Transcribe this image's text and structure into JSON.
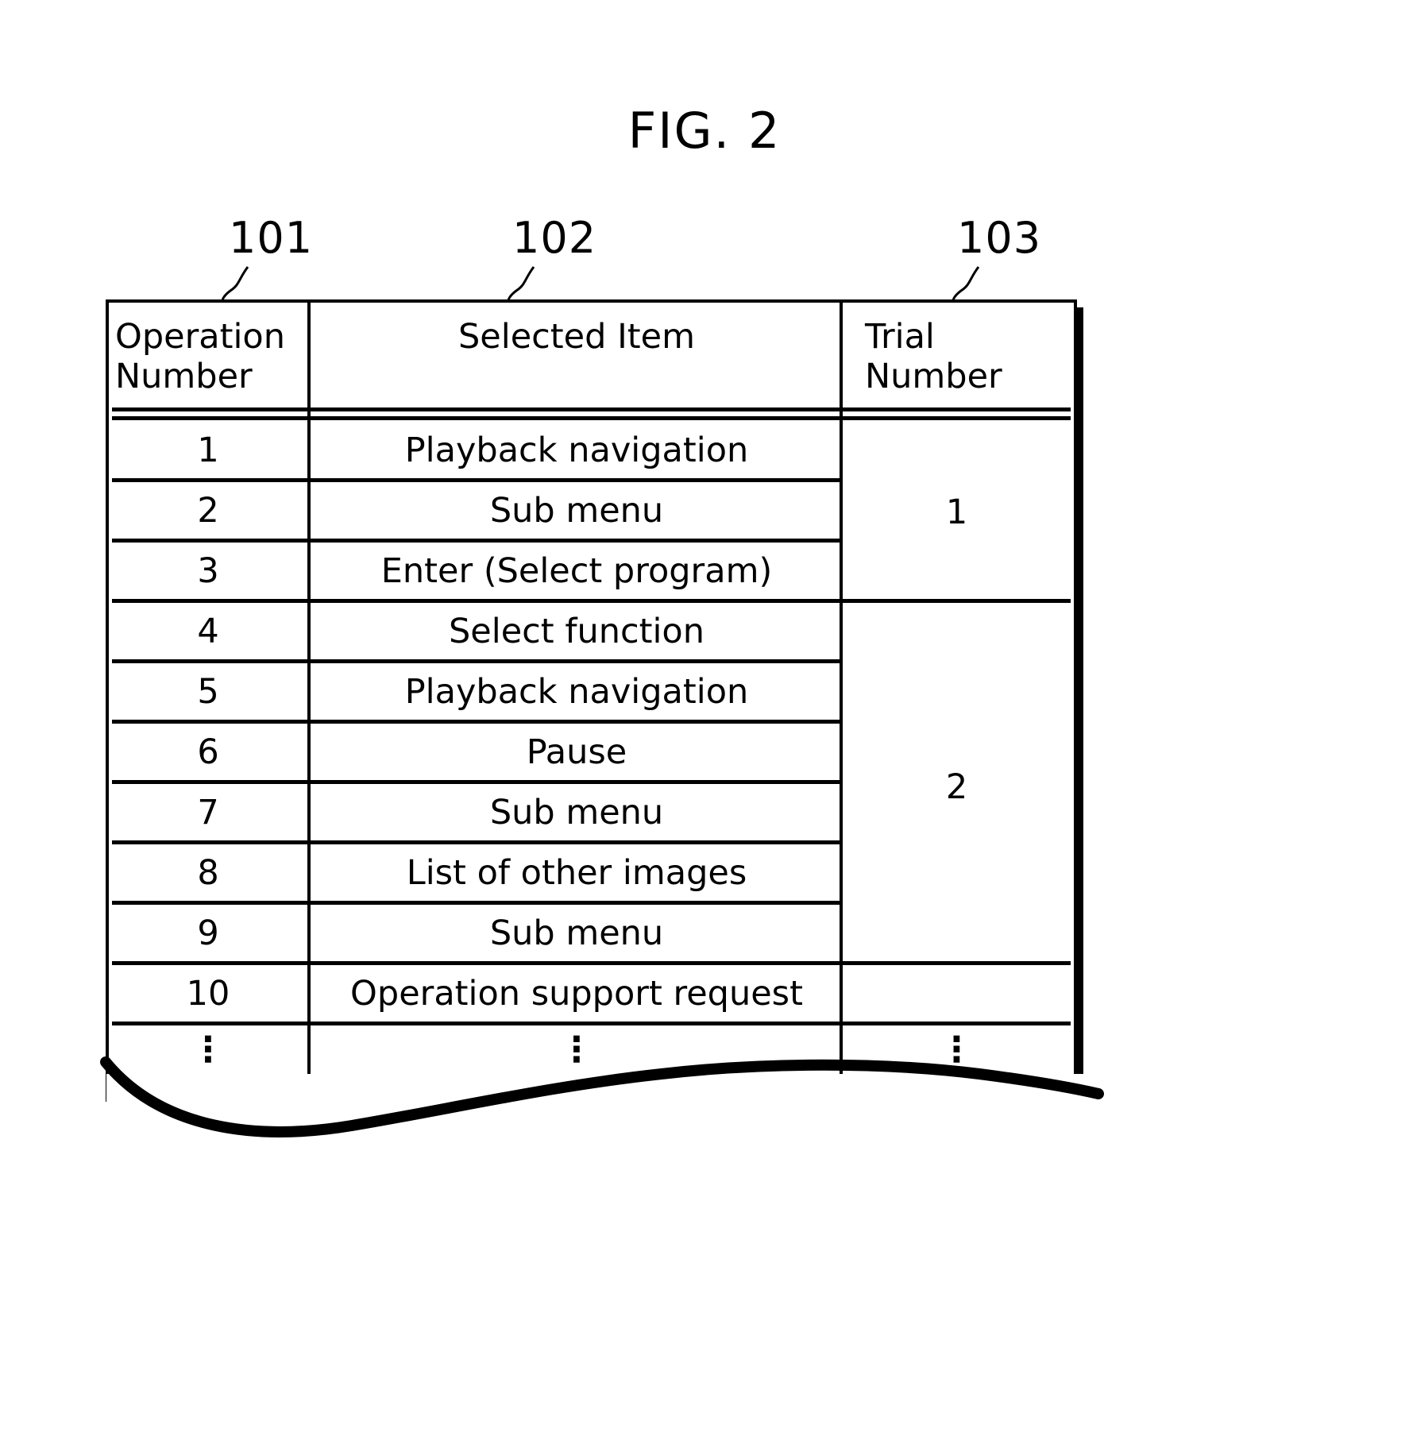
{
  "figure": {
    "title": "FIG. 2"
  },
  "callouts": [
    {
      "id": "101",
      "label": "101",
      "target": "operation-number-column"
    },
    {
      "id": "102",
      "label": "102",
      "target": "selected-item-column"
    },
    {
      "id": "103",
      "label": "103",
      "target": "trial-number-column"
    }
  ],
  "table": {
    "columns": [
      {
        "key": "operation_number",
        "header_line1": "Operation",
        "header_line2": "Number"
      },
      {
        "key": "selected_item",
        "header_line1": "Selected Item",
        "header_line2": ""
      },
      {
        "key": "trial_number",
        "header_line1": "Trial",
        "header_line2": "Number"
      }
    ],
    "rows": [
      {
        "operation_number": "1",
        "selected_item": "Playback navigation"
      },
      {
        "operation_number": "2",
        "selected_item": "Sub menu"
      },
      {
        "operation_number": "3",
        "selected_item": "Enter (Select program)"
      },
      {
        "operation_number": "4",
        "selected_item": "Select function"
      },
      {
        "operation_number": "5",
        "selected_item": "Playback navigation"
      },
      {
        "operation_number": "6",
        "selected_item": "Pause"
      },
      {
        "operation_number": "7",
        "selected_item": "Sub menu"
      },
      {
        "operation_number": "8",
        "selected_item": "List of other images"
      },
      {
        "operation_number": "9",
        "selected_item": "Sub menu"
      },
      {
        "operation_number": "10",
        "selected_item": "Operation support request"
      }
    ],
    "trial_groups": [
      {
        "trial_number": "1",
        "covers_rows": "1-3"
      },
      {
        "trial_number": "2",
        "covers_rows": "4-9"
      },
      {
        "trial_number": "",
        "covers_rows": "10"
      }
    ],
    "continuation": {
      "operation_number": "⋮",
      "selected_item": "⋮",
      "trial_number": "⋮"
    }
  },
  "colors": {
    "ink": "#000000",
    "paper": "#ffffff"
  }
}
